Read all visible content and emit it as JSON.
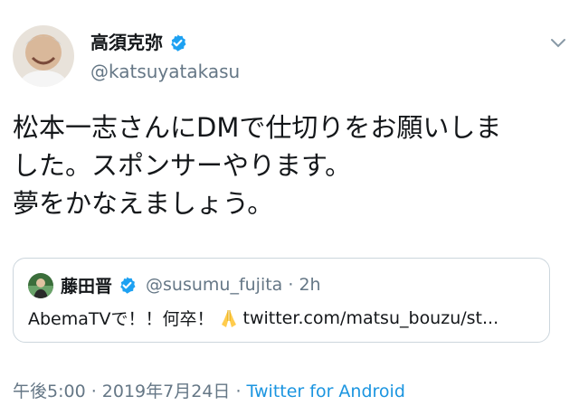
{
  "tweet": {
    "author": {
      "name": "高須克弥",
      "handle": "@katsuyatakasu",
      "verified": true
    },
    "text": "松本一志さんにDMで仕切りをお願いしま\nした。スポンサーやります。\n夢をかなえましょう。",
    "quoted": {
      "name": "藤田晋",
      "handle": "@susumu_fujita",
      "separator": " · ",
      "time": "2h",
      "text_before": "AbemaTVで！！何卒！",
      "text_link": "twitter.com/matsu_bouzu/st...",
      "emoji": "folded-hands"
    },
    "meta": {
      "time": "午後5:00",
      "sep1": " · ",
      "date": "2019年7月24日",
      "sep2": " · ",
      "source": "Twitter for Android"
    }
  },
  "colors": {
    "text": "#14171a",
    "muted": "#657786",
    "link": "#1b95e0",
    "border": "#ccd6dd",
    "verified": "#1da1f2"
  }
}
